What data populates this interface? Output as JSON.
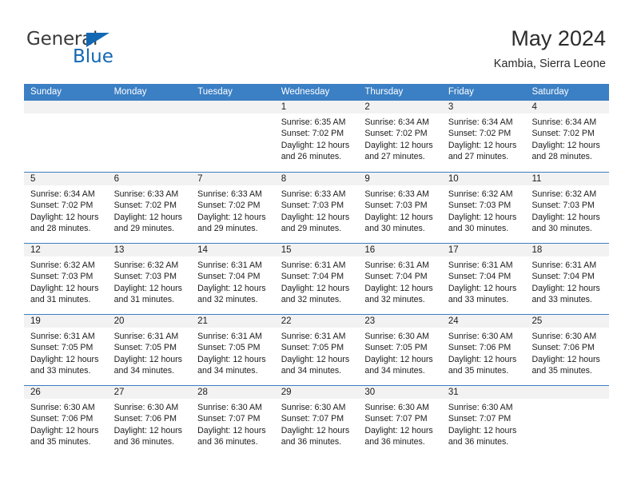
{
  "brand": {
    "name_part1": "General",
    "name_part2": "Blue",
    "triangle_color": "#1268b3"
  },
  "header": {
    "title": "May 2024",
    "subtitle": "Kambia, Sierra Leone",
    "accent_color": "#3b7fc4",
    "day_band_color": "#f2f2f2"
  },
  "weekdays": [
    "Sunday",
    "Monday",
    "Tuesday",
    "Wednesday",
    "Thursday",
    "Friday",
    "Saturday"
  ],
  "labels": {
    "sunrise_prefix": "Sunrise:",
    "sunset_prefix": "Sunset:",
    "daylight_prefix": "Daylight:"
  },
  "weeks": [
    [
      {
        "day": "",
        "sunrise": "",
        "sunset": "",
        "daylight_line1": "",
        "daylight_line2": ""
      },
      {
        "day": "",
        "sunrise": "",
        "sunset": "",
        "daylight_line1": "",
        "daylight_line2": ""
      },
      {
        "day": "",
        "sunrise": "",
        "sunset": "",
        "daylight_line1": "",
        "daylight_line2": ""
      },
      {
        "day": "1",
        "sunrise": "Sunrise: 6:35 AM",
        "sunset": "Sunset: 7:02 PM",
        "daylight_line1": "Daylight: 12 hours",
        "daylight_line2": "and 26 minutes."
      },
      {
        "day": "2",
        "sunrise": "Sunrise: 6:34 AM",
        "sunset": "Sunset: 7:02 PM",
        "daylight_line1": "Daylight: 12 hours",
        "daylight_line2": "and 27 minutes."
      },
      {
        "day": "3",
        "sunrise": "Sunrise: 6:34 AM",
        "sunset": "Sunset: 7:02 PM",
        "daylight_line1": "Daylight: 12 hours",
        "daylight_line2": "and 27 minutes."
      },
      {
        "day": "4",
        "sunrise": "Sunrise: 6:34 AM",
        "sunset": "Sunset: 7:02 PM",
        "daylight_line1": "Daylight: 12 hours",
        "daylight_line2": "and 28 minutes."
      }
    ],
    [
      {
        "day": "5",
        "sunrise": "Sunrise: 6:34 AM",
        "sunset": "Sunset: 7:02 PM",
        "daylight_line1": "Daylight: 12 hours",
        "daylight_line2": "and 28 minutes."
      },
      {
        "day": "6",
        "sunrise": "Sunrise: 6:33 AM",
        "sunset": "Sunset: 7:02 PM",
        "daylight_line1": "Daylight: 12 hours",
        "daylight_line2": "and 29 minutes."
      },
      {
        "day": "7",
        "sunrise": "Sunrise: 6:33 AM",
        "sunset": "Sunset: 7:02 PM",
        "daylight_line1": "Daylight: 12 hours",
        "daylight_line2": "and 29 minutes."
      },
      {
        "day": "8",
        "sunrise": "Sunrise: 6:33 AM",
        "sunset": "Sunset: 7:03 PM",
        "daylight_line1": "Daylight: 12 hours",
        "daylight_line2": "and 29 minutes."
      },
      {
        "day": "9",
        "sunrise": "Sunrise: 6:33 AM",
        "sunset": "Sunset: 7:03 PM",
        "daylight_line1": "Daylight: 12 hours",
        "daylight_line2": "and 30 minutes."
      },
      {
        "day": "10",
        "sunrise": "Sunrise: 6:32 AM",
        "sunset": "Sunset: 7:03 PM",
        "daylight_line1": "Daylight: 12 hours",
        "daylight_line2": "and 30 minutes."
      },
      {
        "day": "11",
        "sunrise": "Sunrise: 6:32 AM",
        "sunset": "Sunset: 7:03 PM",
        "daylight_line1": "Daylight: 12 hours",
        "daylight_line2": "and 30 minutes."
      }
    ],
    [
      {
        "day": "12",
        "sunrise": "Sunrise: 6:32 AM",
        "sunset": "Sunset: 7:03 PM",
        "daylight_line1": "Daylight: 12 hours",
        "daylight_line2": "and 31 minutes."
      },
      {
        "day": "13",
        "sunrise": "Sunrise: 6:32 AM",
        "sunset": "Sunset: 7:03 PM",
        "daylight_line1": "Daylight: 12 hours",
        "daylight_line2": "and 31 minutes."
      },
      {
        "day": "14",
        "sunrise": "Sunrise: 6:31 AM",
        "sunset": "Sunset: 7:04 PM",
        "daylight_line1": "Daylight: 12 hours",
        "daylight_line2": "and 32 minutes."
      },
      {
        "day": "15",
        "sunrise": "Sunrise: 6:31 AM",
        "sunset": "Sunset: 7:04 PM",
        "daylight_line1": "Daylight: 12 hours",
        "daylight_line2": "and 32 minutes."
      },
      {
        "day": "16",
        "sunrise": "Sunrise: 6:31 AM",
        "sunset": "Sunset: 7:04 PM",
        "daylight_line1": "Daylight: 12 hours",
        "daylight_line2": "and 32 minutes."
      },
      {
        "day": "17",
        "sunrise": "Sunrise: 6:31 AM",
        "sunset": "Sunset: 7:04 PM",
        "daylight_line1": "Daylight: 12 hours",
        "daylight_line2": "and 33 minutes."
      },
      {
        "day": "18",
        "sunrise": "Sunrise: 6:31 AM",
        "sunset": "Sunset: 7:04 PM",
        "daylight_line1": "Daylight: 12 hours",
        "daylight_line2": "and 33 minutes."
      }
    ],
    [
      {
        "day": "19",
        "sunrise": "Sunrise: 6:31 AM",
        "sunset": "Sunset: 7:05 PM",
        "daylight_line1": "Daylight: 12 hours",
        "daylight_line2": "and 33 minutes."
      },
      {
        "day": "20",
        "sunrise": "Sunrise: 6:31 AM",
        "sunset": "Sunset: 7:05 PM",
        "daylight_line1": "Daylight: 12 hours",
        "daylight_line2": "and 34 minutes."
      },
      {
        "day": "21",
        "sunrise": "Sunrise: 6:31 AM",
        "sunset": "Sunset: 7:05 PM",
        "daylight_line1": "Daylight: 12 hours",
        "daylight_line2": "and 34 minutes."
      },
      {
        "day": "22",
        "sunrise": "Sunrise: 6:31 AM",
        "sunset": "Sunset: 7:05 PM",
        "daylight_line1": "Daylight: 12 hours",
        "daylight_line2": "and 34 minutes."
      },
      {
        "day": "23",
        "sunrise": "Sunrise: 6:30 AM",
        "sunset": "Sunset: 7:05 PM",
        "daylight_line1": "Daylight: 12 hours",
        "daylight_line2": "and 34 minutes."
      },
      {
        "day": "24",
        "sunrise": "Sunrise: 6:30 AM",
        "sunset": "Sunset: 7:06 PM",
        "daylight_line1": "Daylight: 12 hours",
        "daylight_line2": "and 35 minutes."
      },
      {
        "day": "25",
        "sunrise": "Sunrise: 6:30 AM",
        "sunset": "Sunset: 7:06 PM",
        "daylight_line1": "Daylight: 12 hours",
        "daylight_line2": "and 35 minutes."
      }
    ],
    [
      {
        "day": "26",
        "sunrise": "Sunrise: 6:30 AM",
        "sunset": "Sunset: 7:06 PM",
        "daylight_line1": "Daylight: 12 hours",
        "daylight_line2": "and 35 minutes."
      },
      {
        "day": "27",
        "sunrise": "Sunrise: 6:30 AM",
        "sunset": "Sunset: 7:06 PM",
        "daylight_line1": "Daylight: 12 hours",
        "daylight_line2": "and 36 minutes."
      },
      {
        "day": "28",
        "sunrise": "Sunrise: 6:30 AM",
        "sunset": "Sunset: 7:07 PM",
        "daylight_line1": "Daylight: 12 hours",
        "daylight_line2": "and 36 minutes."
      },
      {
        "day": "29",
        "sunrise": "Sunrise: 6:30 AM",
        "sunset": "Sunset: 7:07 PM",
        "daylight_line1": "Daylight: 12 hours",
        "daylight_line2": "and 36 minutes."
      },
      {
        "day": "30",
        "sunrise": "Sunrise: 6:30 AM",
        "sunset": "Sunset: 7:07 PM",
        "daylight_line1": "Daylight: 12 hours",
        "daylight_line2": "and 36 minutes."
      },
      {
        "day": "31",
        "sunrise": "Sunrise: 6:30 AM",
        "sunset": "Sunset: 7:07 PM",
        "daylight_line1": "Daylight: 12 hours",
        "daylight_line2": "and 36 minutes."
      },
      {
        "day": "",
        "sunrise": "",
        "sunset": "",
        "daylight_line1": "",
        "daylight_line2": ""
      }
    ]
  ]
}
